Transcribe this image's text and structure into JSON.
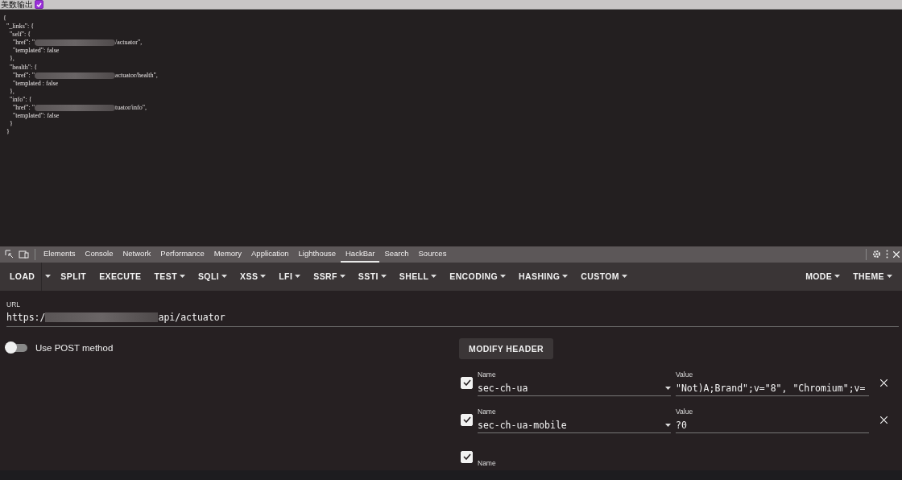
{
  "top_bar": {
    "label": "美数输出",
    "checked": true
  },
  "json_view": {
    "lines": [
      {
        "kind": "plain",
        "text": "{"
      },
      {
        "kind": "plain",
        "text": "  \"_links\": {"
      },
      {
        "kind": "plain",
        "text": "    \"self\": {"
      },
      {
        "kind": "redacted",
        "before": "      \"href\": \"",
        "after": "/actuator\","
      },
      {
        "kind": "plain",
        "text": "      \"templated\": false"
      },
      {
        "kind": "plain",
        "text": "    },"
      },
      {
        "kind": "plain",
        "text": "    \"health\": {"
      },
      {
        "kind": "redacted",
        "before": "      \"href\": \"",
        "after": "actuator/health\","
      },
      {
        "kind": "plain",
        "text": "      \"templated : false"
      },
      {
        "kind": "plain",
        "text": "    },"
      },
      {
        "kind": "plain",
        "text": "    \"info\": {"
      },
      {
        "kind": "redacted",
        "before": "      \"href\": \"",
        "after": "tuator/info\","
      },
      {
        "kind": "plain",
        "text": "      \"templated\": false"
      },
      {
        "kind": "plain",
        "text": "    }"
      },
      {
        "kind": "plain",
        "text": "  }"
      }
    ]
  },
  "devtools_tabs": [
    {
      "label": "Elements",
      "selected": false
    },
    {
      "label": "Console",
      "selected": false
    },
    {
      "label": "Network",
      "selected": false
    },
    {
      "label": "Performance",
      "selected": false
    },
    {
      "label": "Memory",
      "selected": false
    },
    {
      "label": "Application",
      "selected": false
    },
    {
      "label": "Lighthouse",
      "selected": false
    },
    {
      "label": "HackBar",
      "selected": true
    },
    {
      "label": "Search",
      "selected": false
    },
    {
      "label": "Sources",
      "selected": false
    }
  ],
  "toolbar": {
    "left": [
      {
        "label": "LOAD",
        "kind": "split"
      },
      {
        "label": "SPLIT",
        "kind": "plain"
      },
      {
        "label": "EXECUTE",
        "kind": "plain"
      },
      {
        "label": "TEST",
        "kind": "menu"
      },
      {
        "label": "SQLI",
        "kind": "menu"
      },
      {
        "label": "XSS",
        "kind": "menu"
      },
      {
        "label": "LFI",
        "kind": "menu"
      },
      {
        "label": "SSRF",
        "kind": "menu"
      },
      {
        "label": "SSTI",
        "kind": "menu"
      },
      {
        "label": "SHELL",
        "kind": "menu"
      },
      {
        "label": "ENCODING",
        "kind": "menu"
      },
      {
        "label": "HASHING",
        "kind": "menu"
      },
      {
        "label": "CUSTOM",
        "kind": "menu"
      }
    ],
    "right": [
      {
        "label": "MODE",
        "kind": "menu"
      },
      {
        "label": "THEME",
        "kind": "menu"
      }
    ]
  },
  "url": {
    "label": "URL",
    "before": "https:/",
    "after": "api/actuator"
  },
  "post_toggle": {
    "label": "Use POST method",
    "on": false
  },
  "modify_header": "MODIFY HEADER",
  "headers": [
    {
      "checked": true,
      "name_label": "Name",
      "name": "sec-ch-ua",
      "value_label": "Value",
      "value": "\"Not)A;Brand\";v=\"8\", \"Chromium\";v="
    },
    {
      "checked": true,
      "name_label": "Name",
      "name": "sec-ch-ua-mobile",
      "value_label": "Value",
      "value": "?0"
    },
    {
      "checked": true,
      "name_label": "Name"
    }
  ]
}
